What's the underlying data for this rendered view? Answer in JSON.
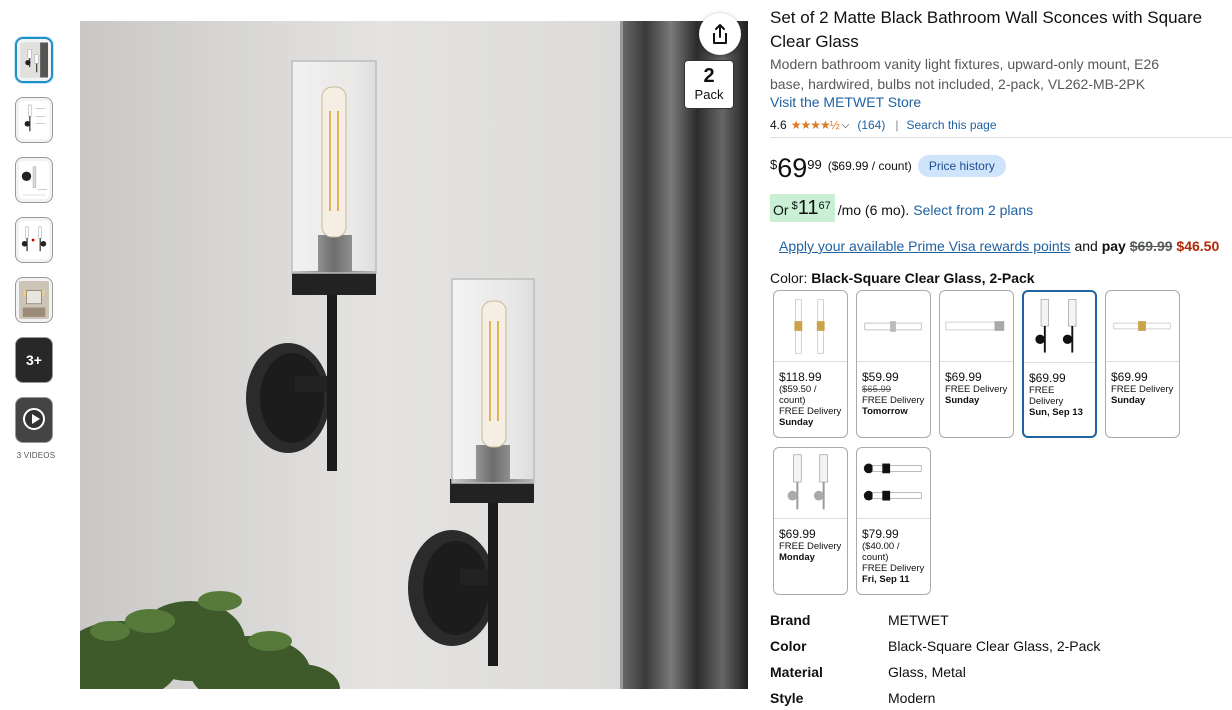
{
  "gallery": {
    "more_label": "3+",
    "videos_label": "3 VIDEOS",
    "pack_badge": {
      "number": "2",
      "label": "Pack"
    }
  },
  "product": {
    "title": "Set of 2 Matte Black Bathroom Wall Sconces with Square Clear Glass",
    "subtitle": "Modern bathroom vanity light fixtures, upward-only mount, E26 base, hardwired, bulbs not included, 2-pack, VL262-MB-2PK",
    "store_link": "Visit the METWET Store",
    "rating": "4.6",
    "stars": "★★★★½",
    "rating_count": "(164)",
    "search_page": "Search this page"
  },
  "price": {
    "symbol": "$",
    "whole": "69",
    "fraction": "99",
    "per_unit": "($69.99 / count)",
    "price_history": "Price history"
  },
  "installment": {
    "or": "Or",
    "symbol": "$",
    "whole": "11",
    "fraction": "67",
    "term": "/mo (6 mo).",
    "plans_link": "Select from 2 plans"
  },
  "visa": {
    "link": "Apply your available Prime Visa rewards points",
    "and_pay": "and",
    "pay": "pay",
    "old_price": "$69.99",
    "new_price": "$46.50"
  },
  "color": {
    "label": "Color:",
    "value": "Black-Square Clear Glass, 2-Pack"
  },
  "swatches": [
    {
      "price": "$118.99",
      "unit": "($59.50 / count)",
      "list": "",
      "delivery": "FREE Delivery",
      "day": "Sunday",
      "selected": false
    },
    {
      "price": "$59.99",
      "unit": "",
      "list": "$65.99",
      "delivery": "FREE Delivery",
      "day": "Tomorrow",
      "selected": false
    },
    {
      "price": "$69.99",
      "unit": "",
      "list": "",
      "delivery": "FREE Delivery",
      "day": "Sunday",
      "selected": false
    },
    {
      "price": "$69.99",
      "unit": "",
      "list": "",
      "delivery": "FREE Delivery",
      "day": "Sun, Sep 13",
      "selected": true
    },
    {
      "price": "$69.99",
      "unit": "",
      "list": "",
      "delivery": "FREE Delivery",
      "day": "Sunday",
      "selected": false
    },
    {
      "price": "$69.99",
      "unit": "",
      "list": "",
      "delivery": "FREE Delivery",
      "day": "Monday",
      "selected": false
    },
    {
      "price": "$79.99",
      "unit": "($40.00 / count)",
      "list": "",
      "delivery": "FREE Delivery",
      "day": "Fri, Sep 11",
      "selected": false
    }
  ],
  "specs": [
    {
      "key": "Brand",
      "value": "METWET"
    },
    {
      "key": "Color",
      "value": "Black-Square Clear Glass, 2-Pack"
    },
    {
      "key": "Material",
      "value": "Glass, Metal"
    },
    {
      "key": "Style",
      "value": "Modern"
    }
  ],
  "colors": {
    "link": "#2162a1",
    "deal_red": "#b12704",
    "star": "#de7921",
    "installment_bg": "#c9f0d5",
    "history_bg": "#cfe4fb"
  },
  "icons": [
    "share-icon",
    "play-icon",
    "star-icon",
    "chevron-down-icon"
  ]
}
